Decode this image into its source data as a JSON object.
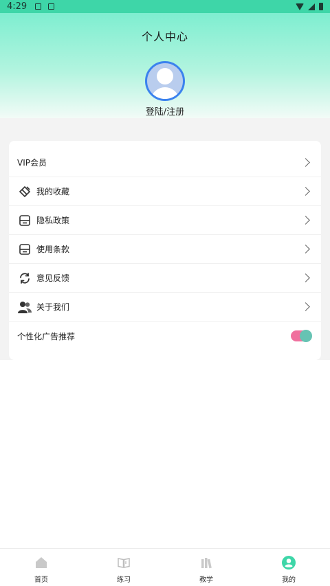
{
  "status_bar": {
    "time": "4:29"
  },
  "header": {
    "title": "个人中心",
    "login_label": "登陆/注册"
  },
  "menu": {
    "items": [
      {
        "label": "VIP会员",
        "icon": "none"
      },
      {
        "label": "我的收藏",
        "icon": "favorite-icon"
      },
      {
        "label": "隐私政策",
        "icon": "privacy-icon"
      },
      {
        "label": "使用条款",
        "icon": "terms-icon"
      },
      {
        "label": "意见反馈",
        "icon": "feedback-icon"
      },
      {
        "label": "关于我们",
        "icon": "about-icon"
      }
    ],
    "ad_toggle": {
      "label": "个性化广告推荐",
      "enabled": true
    }
  },
  "bottom_nav": {
    "items": [
      {
        "label": "首页",
        "icon": "home-icon",
        "active": false
      },
      {
        "label": "练习",
        "icon": "book-icon",
        "active": false
      },
      {
        "label": "教学",
        "icon": "books-icon",
        "active": false
      },
      {
        "label": "我的",
        "icon": "user-icon",
        "active": true
      }
    ]
  },
  "colors": {
    "accent": "#3ed6a8",
    "toggle_track": "#f0709e",
    "toggle_knob": "#66c3b3",
    "avatar_border": "#3b82ee"
  }
}
